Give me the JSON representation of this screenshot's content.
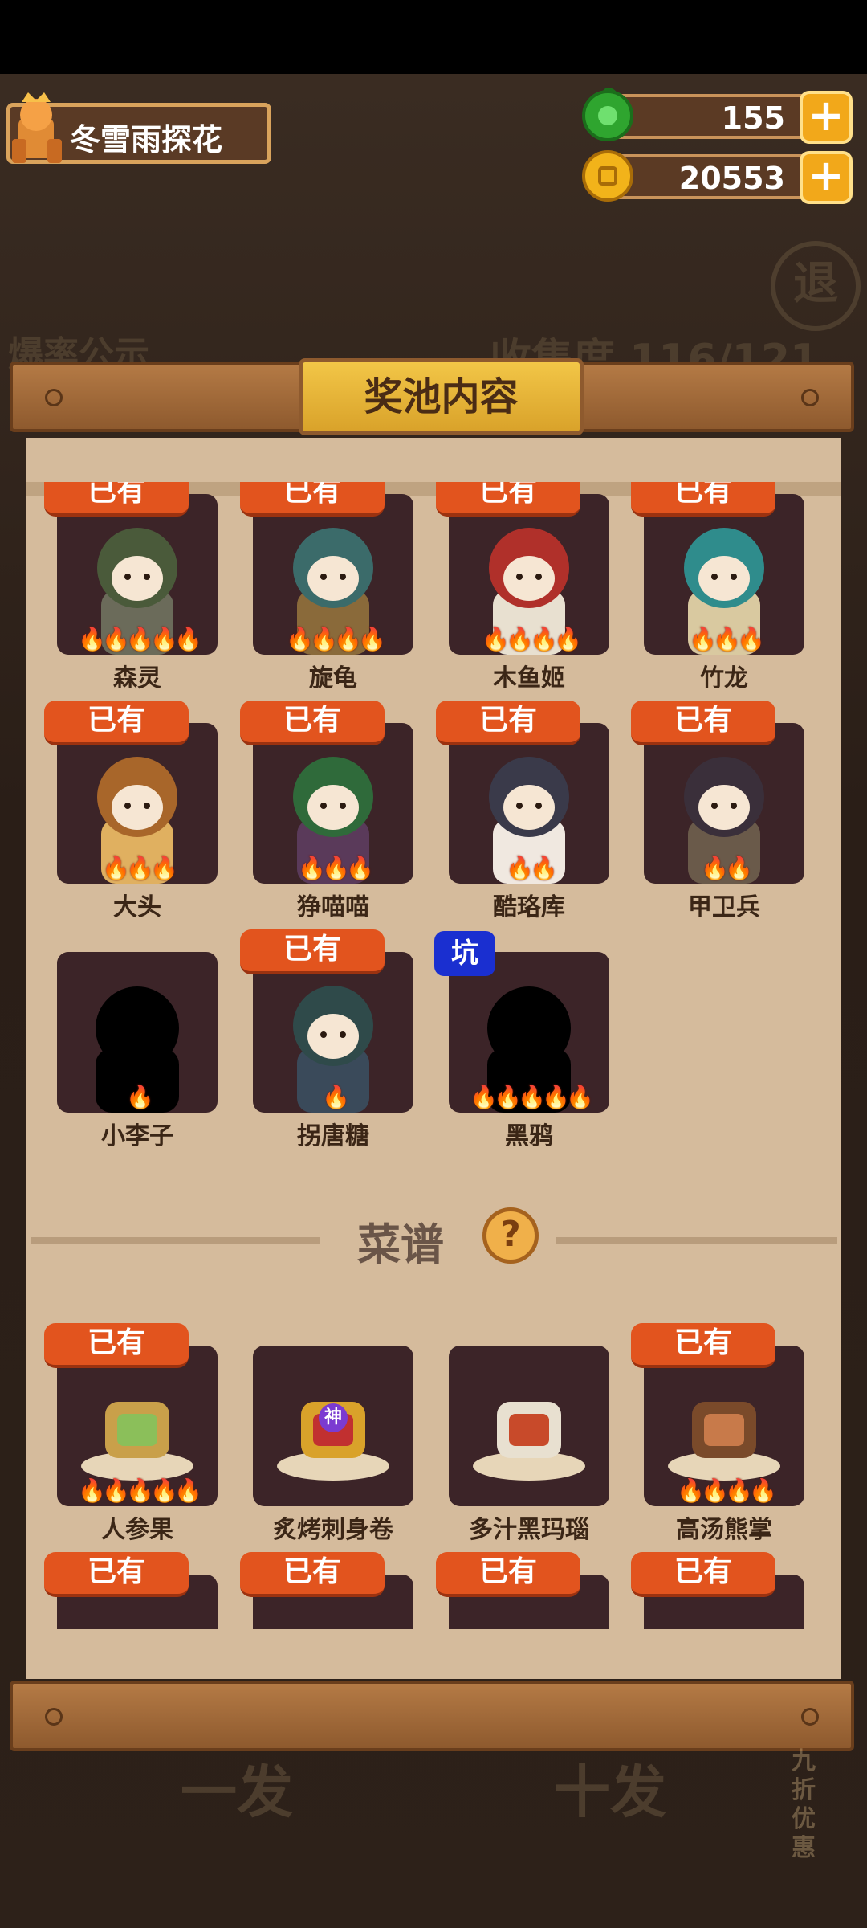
{
  "player": {
    "name": "冬雪雨探花"
  },
  "currencies": [
    {
      "name": "jade",
      "value": "155",
      "icon": "green-jade-icon",
      "color": "#34b934"
    },
    {
      "name": "coins",
      "value": "20553",
      "icon": "gold-coin-icon",
      "color": "#f2b31a"
    }
  ],
  "background": {
    "exit_button": "退",
    "left_tab": "爆率公示",
    "collection": "收集度 116/121",
    "draw_once": "一发",
    "draw_ten": "十发",
    "promo": "九折优惠"
  },
  "panel": {
    "title": "奖池内容"
  },
  "characters": [
    {
      "name": "森灵",
      "owned": "已有",
      "flames": 5
    },
    {
      "name": "旋龟",
      "owned": "已有",
      "flames": 4
    },
    {
      "name": "木鱼姬",
      "owned": "已有",
      "flames": 4
    },
    {
      "name": "竹龙",
      "owned": "已有",
      "flames": 3
    },
    {
      "name": "大头",
      "owned": "已有",
      "flames": 3
    },
    {
      "name": "狰喵喵",
      "owned": "已有",
      "flames": 3
    },
    {
      "name": "酷珞库",
      "owned": "已有",
      "flames": 2
    },
    {
      "name": "甲卫兵",
      "owned": "已有",
      "flames": 2
    },
    {
      "name": "小李子",
      "owned": "",
      "flames": 1
    },
    {
      "name": "拐唐糖",
      "owned": "已有",
      "flames": 1
    },
    {
      "name": "黑鸦",
      "owned": "",
      "pit": "坑",
      "flames": 5
    }
  ],
  "recipes_section": {
    "title": "菜谱",
    "help": "?"
  },
  "recipes": [
    {
      "name": "人参果",
      "owned": "已有",
      "flames": 5
    },
    {
      "name": "炙烤刺身卷",
      "owned": "",
      "badge": "神",
      "flames": 0
    },
    {
      "name": "多汁黑玛瑙",
      "owned": "",
      "flames": 0
    },
    {
      "name": "高汤熊掌",
      "owned": "已有",
      "flames": 4
    },
    {
      "name": "",
      "owned": "已有",
      "flames": 0
    },
    {
      "name": "",
      "owned": "已有",
      "flames": 0
    },
    {
      "name": "",
      "owned": "已有",
      "flames": 0
    },
    {
      "name": "",
      "owned": "已有",
      "flames": 0
    }
  ]
}
